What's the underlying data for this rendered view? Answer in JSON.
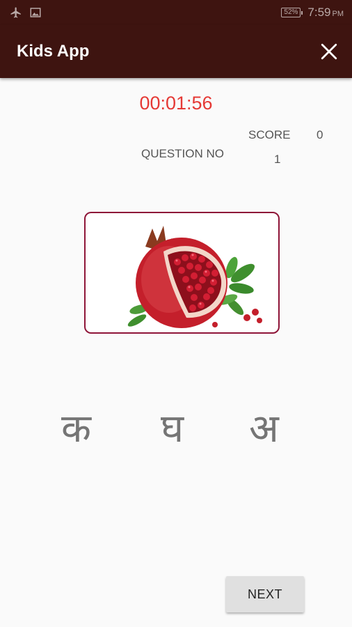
{
  "status_bar": {
    "battery": "52%",
    "time": "7:59",
    "ampm": "PM",
    "icons": [
      "airplane-icon",
      "gallery-icon"
    ]
  },
  "app_bar": {
    "title": "Kids App",
    "close_icon": "close-icon"
  },
  "quiz": {
    "timer": "00:01:56",
    "score_label": "SCORE",
    "score_value": "0",
    "question_label": "QUESTION NO",
    "question_value": "1",
    "image_icon": "pomegranate-image",
    "options": [
      "क",
      "घ",
      "अ"
    ],
    "next_label": "NEXT"
  },
  "colors": {
    "app_bar": "#3e1410",
    "timer": "#e53935",
    "card_border": "#8e1538"
  }
}
